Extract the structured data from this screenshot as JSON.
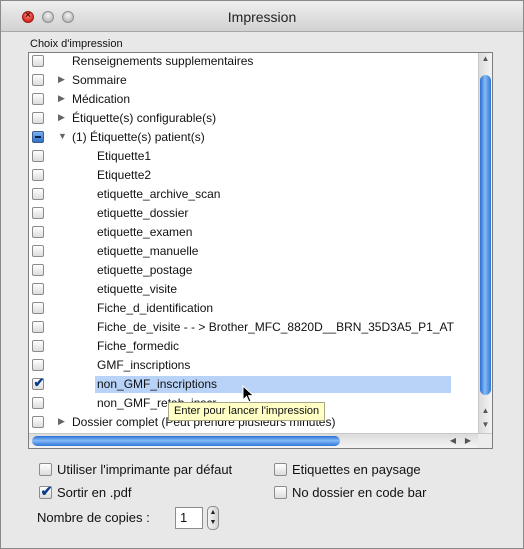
{
  "window": {
    "title": "Impression"
  },
  "section_label": "Choix d'impression",
  "list_items": [
    {
      "label": "Renseignements supplementaires",
      "checked": false,
      "mixed": false,
      "expander": "none",
      "indent": 0,
      "selected": false
    },
    {
      "label": "Sommaire",
      "checked": false,
      "mixed": false,
      "expander": "collapsed",
      "indent": 0,
      "selected": false
    },
    {
      "label": "Médication",
      "checked": false,
      "mixed": false,
      "expander": "collapsed",
      "indent": 0,
      "selected": false
    },
    {
      "label": "Étiquette(s) configurable(s)",
      "checked": false,
      "mixed": false,
      "expander": "collapsed",
      "indent": 0,
      "selected": false
    },
    {
      "label": "(1) Étiquette(s) patient(s)",
      "checked": false,
      "mixed": true,
      "expander": "expanded",
      "indent": 0,
      "selected": false
    },
    {
      "label": "Etiquette1",
      "checked": false,
      "mixed": false,
      "expander": "none",
      "indent": 1,
      "selected": false
    },
    {
      "label": "Etiquette2",
      "checked": false,
      "mixed": false,
      "expander": "none",
      "indent": 1,
      "selected": false
    },
    {
      "label": "etiquette_archive_scan",
      "checked": false,
      "mixed": false,
      "expander": "none",
      "indent": 1,
      "selected": false
    },
    {
      "label": "etiquette_dossier",
      "checked": false,
      "mixed": false,
      "expander": "none",
      "indent": 1,
      "selected": false
    },
    {
      "label": "etiquette_examen",
      "checked": false,
      "mixed": false,
      "expander": "none",
      "indent": 1,
      "selected": false
    },
    {
      "label": "etiquette_manuelle",
      "checked": false,
      "mixed": false,
      "expander": "none",
      "indent": 1,
      "selected": false
    },
    {
      "label": "etiquette_postage",
      "checked": false,
      "mixed": false,
      "expander": "none",
      "indent": 1,
      "selected": false
    },
    {
      "label": "etiquette_visite",
      "checked": false,
      "mixed": false,
      "expander": "none",
      "indent": 1,
      "selected": false
    },
    {
      "label": "Fiche_d_identification",
      "checked": false,
      "mixed": false,
      "expander": "none",
      "indent": 1,
      "selected": false
    },
    {
      "label": "Fiche_de_visite - - > Brother_MFC_8820D__BRN_35D3A5_P1_AT",
      "checked": false,
      "mixed": false,
      "expander": "none",
      "indent": 1,
      "selected": false
    },
    {
      "label": "Fiche_formedic",
      "checked": false,
      "mixed": false,
      "expander": "none",
      "indent": 1,
      "selected": false
    },
    {
      "label": "GMF_inscriptions",
      "checked": false,
      "mixed": false,
      "expander": "none",
      "indent": 1,
      "selected": false
    },
    {
      "label": "non_GMF_inscriptions",
      "checked": true,
      "mixed": false,
      "expander": "none",
      "indent": 1,
      "selected": true
    },
    {
      "label": "non_GMF_retab_inscr",
      "checked": false,
      "mixed": false,
      "expander": "none",
      "indent": 1,
      "selected": false
    },
    {
      "label": "Dossier complet (Peut prendre plusieurs minutes)",
      "checked": false,
      "mixed": false,
      "expander": "collapsed",
      "indent": 0,
      "selected": false
    }
  ],
  "tooltip": "Enter pour lancer l'impression",
  "options": {
    "use_default_printer": {
      "label": "Utiliser l'imprimante par défaut",
      "checked": false
    },
    "landscape_labels": {
      "label": "Etiquettes en paysage",
      "checked": false
    },
    "pdf_output": {
      "label": "Sortir en .pdf",
      "checked": true
    },
    "no_barcode": {
      "label": "No dossier en code bar",
      "checked": false
    }
  },
  "copies": {
    "label": "Nombre de copies :",
    "value": "1"
  },
  "icons": {
    "checkmark": "✔",
    "triangle_collapsed": "▶",
    "triangle_expanded": "▼",
    "arrow_up": "▲",
    "arrow_down": "▼",
    "arrow_left": "◀",
    "arrow_right": "▶"
  },
  "colors": {
    "selection": "#b8d3f7",
    "scroll_thumb": "#2f77d9",
    "tooltip_bg": "#ffffc6"
  }
}
